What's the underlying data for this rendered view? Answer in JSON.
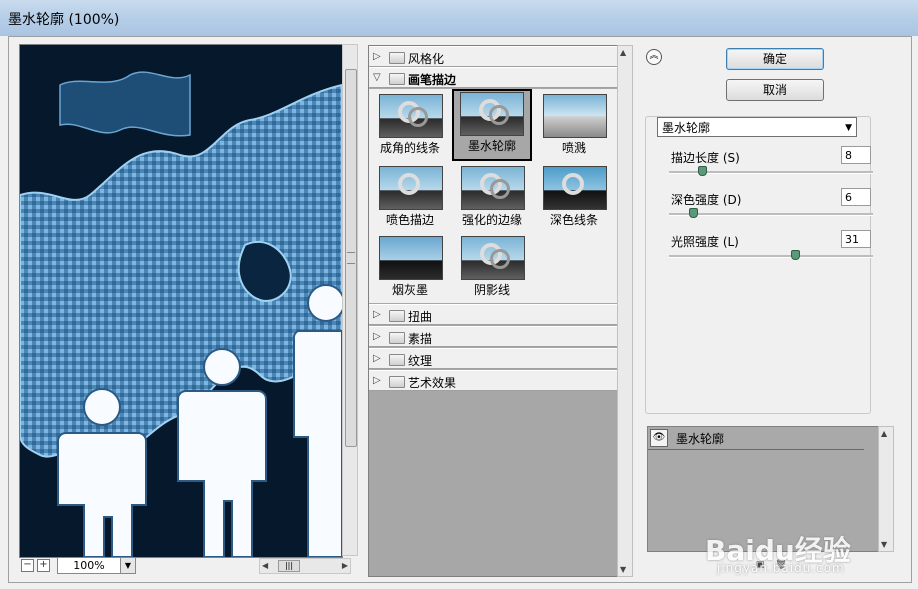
{
  "window": {
    "title": "墨水轮廓 (100%)"
  },
  "preview": {
    "zoom": "100%"
  },
  "filter_gallery": {
    "categories": [
      {
        "label": "风格化",
        "open": false
      },
      {
        "label": "画笔描边",
        "open": true
      },
      {
        "label": "扭曲",
        "open": false
      },
      {
        "label": "素描",
        "open": false
      },
      {
        "label": "纹理",
        "open": false
      },
      {
        "label": "艺术效果",
        "open": false
      }
    ],
    "brush_filters": [
      {
        "label": "成角的线条",
        "selected": false
      },
      {
        "label": "墨水轮廓",
        "selected": true
      },
      {
        "label": "喷溅",
        "selected": false
      },
      {
        "label": "喷色描边",
        "selected": false
      },
      {
        "label": "强化的边缘",
        "selected": false
      },
      {
        "label": "深色线条",
        "selected": false
      },
      {
        "label": "烟灰墨",
        "selected": false
      },
      {
        "label": "阴影线",
        "selected": false
      }
    ]
  },
  "buttons": {
    "ok": "确定",
    "cancel": "取消"
  },
  "settings": {
    "filter_select": "墨水轮廓",
    "params": [
      {
        "label": "描边长度 (S)",
        "value": "8",
        "fraction": 0.16
      },
      {
        "label": "深色强度 (D)",
        "value": "6",
        "fraction": 0.12
      },
      {
        "label": "光照强度 (L)",
        "value": "31",
        "fraction": 0.62
      }
    ]
  },
  "layers": {
    "items": [
      {
        "name": "墨水轮廓"
      }
    ]
  },
  "watermark": {
    "brand": "Baidu经验",
    "url": "jingyan.baidu.com"
  },
  "colors": {
    "preview_bg": "#06182b",
    "panel_gray": "#a7a7a7",
    "accent_blue": "#3c7fb1"
  }
}
